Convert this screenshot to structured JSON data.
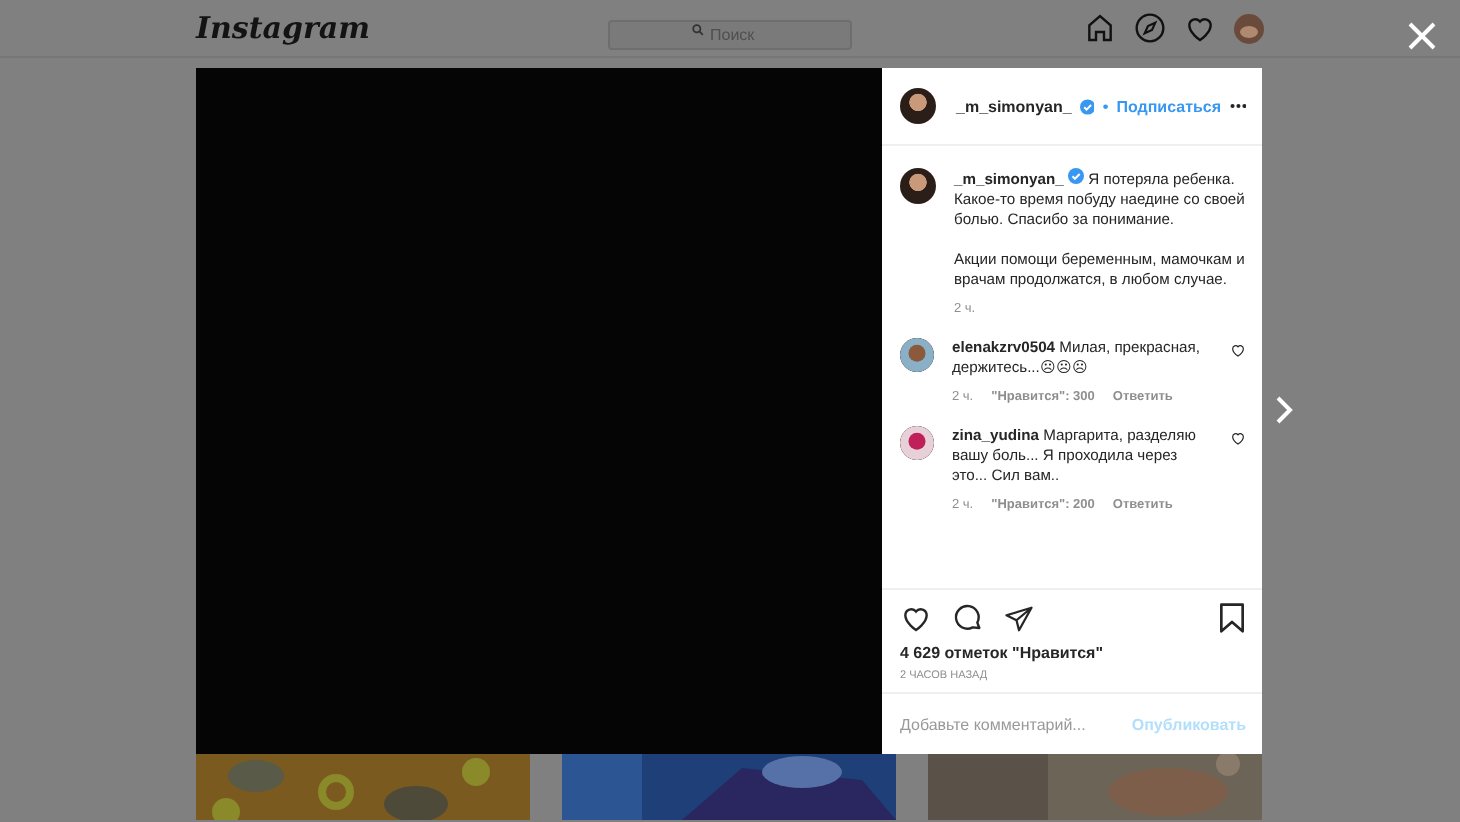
{
  "header": {
    "logo": "Instagram",
    "search": {
      "placeholder": "Поиск"
    }
  },
  "post": {
    "author": "_m_simonyan_",
    "verified": true,
    "separator": "•",
    "follow": "Подписаться",
    "caption": {
      "author": "_m_simonyan_",
      "verified": true,
      "paragraphs": [
        "Я потеряла ребенка. Какое-то время побуду наедине со своей болью. Спасибо за понимание.",
        "Акции помощи беременным, мамочкам и врачам продолжатся, в любом случае."
      ],
      "time": "2 ч."
    },
    "comments": [
      {
        "author": "elenakzrv0504",
        "text": "Милая, прекрасная, держитесь...☹☹☹",
        "time": "2 ч.",
        "likes": "\"Нравится\": 300",
        "reply": "Ответить",
        "liked": false
      },
      {
        "author": "zina_yudina",
        "text": "Маргарита, разделяю вашу боль... Я проходила через это... Сил вам..",
        "time": "2 ч.",
        "likes": "\"Нравится\": 200",
        "reply": "Ответить",
        "liked": false
      }
    ],
    "liked": false,
    "saved": false,
    "like_count": "4 629 отметок \"Нравится\"",
    "posted": "2 ЧАСОВ НАЗАД",
    "comment_field": {
      "placeholder": "Добавьте комментарий..."
    },
    "publish": "Опубликовать"
  }
}
